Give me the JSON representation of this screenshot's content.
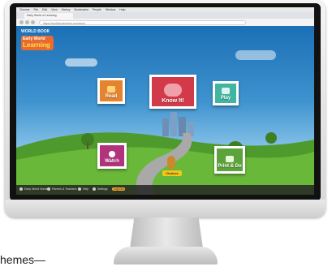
{
  "caption": "hemes—",
  "browser": {
    "menu": [
      "Chrome",
      "File",
      "Edit",
      "View",
      "History",
      "Bookmarks",
      "People",
      "Window",
      "Help"
    ],
    "tab_title": "Early World of Learning",
    "url": "https://worldbookonline.com/ewol"
  },
  "app": {
    "brand": "WORLD BOOK",
    "title_line1": "Early World",
    "title_line2": "Learning",
    "cards": {
      "read": "Read",
      "know": "Know It!",
      "play": "Play",
      "watch": "Watch",
      "print": "Print & Do"
    },
    "choices_label": "Choices",
    "bottom_nav": [
      "Early World Home",
      "Parents & Teachers",
      "Help",
      "Settings",
      "Log Out"
    ]
  },
  "colors": {
    "read": "#e6832f",
    "know": "#d23a4a",
    "play": "#3fb5a2",
    "watch": "#b3327c",
    "print": "#5da33b"
  }
}
